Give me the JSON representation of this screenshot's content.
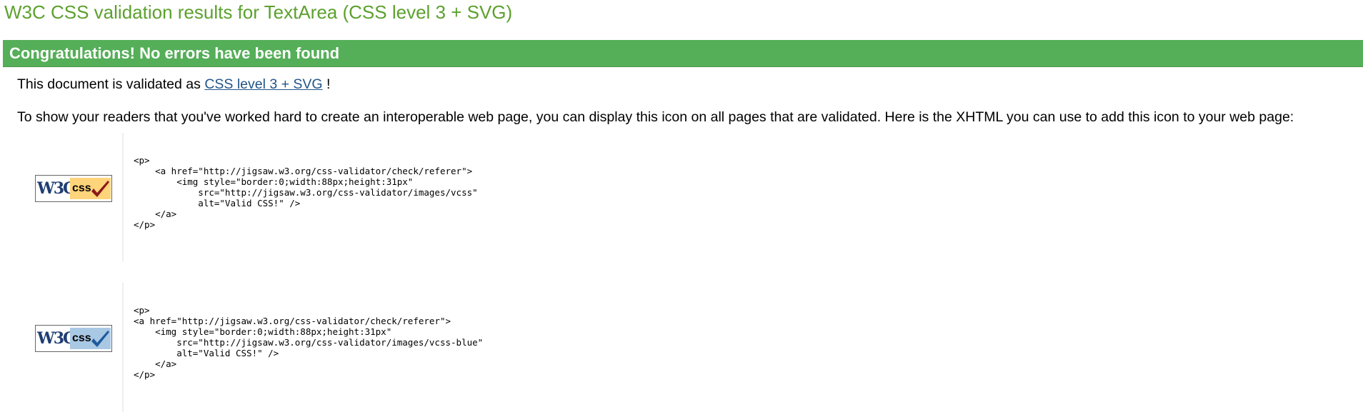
{
  "page": {
    "title": "W3C CSS validation results for TextArea (CSS level 3 + SVG)"
  },
  "banner": {
    "text": "Congratulations! No errors have been found"
  },
  "validated": {
    "prefix": "This document is validated as",
    "link_text": "CSS level 3 + SVG",
    "suffix": "!"
  },
  "info": {
    "text": "To show your readers that you've worked hard to create an interoperable web page, you can display this icon on all pages that are validated. Here is the XHTML you can use to add this icon to your web page:"
  },
  "badges": [
    {
      "name": "vcss-gold",
      "w3c_text": "W3C",
      "css_text": "css",
      "accent": "#ffd47a",
      "check_color": "#8b1a1a",
      "icon": "w3c-valid-css-gold-badge",
      "code": "<p>\n    <a href=\"http://jigsaw.w3.org/css-validator/check/referer\">\n        <img style=\"border:0;width:88px;height:31px\"\n            src=\"http://jigsaw.w3.org/css-validator/images/vcss\"\n            alt=\"Valid CSS!\" />\n    </a>\n</p>"
    },
    {
      "name": "vcss-blue",
      "w3c_text": "W3C",
      "css_text": "css",
      "accent": "#a9c8e4",
      "check_color": "#1e5a9c",
      "icon": "w3c-valid-css-blue-badge",
      "code": "<p>\n<a href=\"http://jigsaw.w3.org/css-validator/check/referer\">\n    <img style=\"border:0;width:88px;height:31px\"\n        src=\"http://jigsaw.w3.org/css-validator/images/vcss-blue\"\n        alt=\"Valid CSS!\" />\n    </a>\n</p>"
    }
  ],
  "colors": {
    "title_green": "#5ca12e",
    "banner_green": "#55ae58",
    "link_blue": "#225588"
  }
}
